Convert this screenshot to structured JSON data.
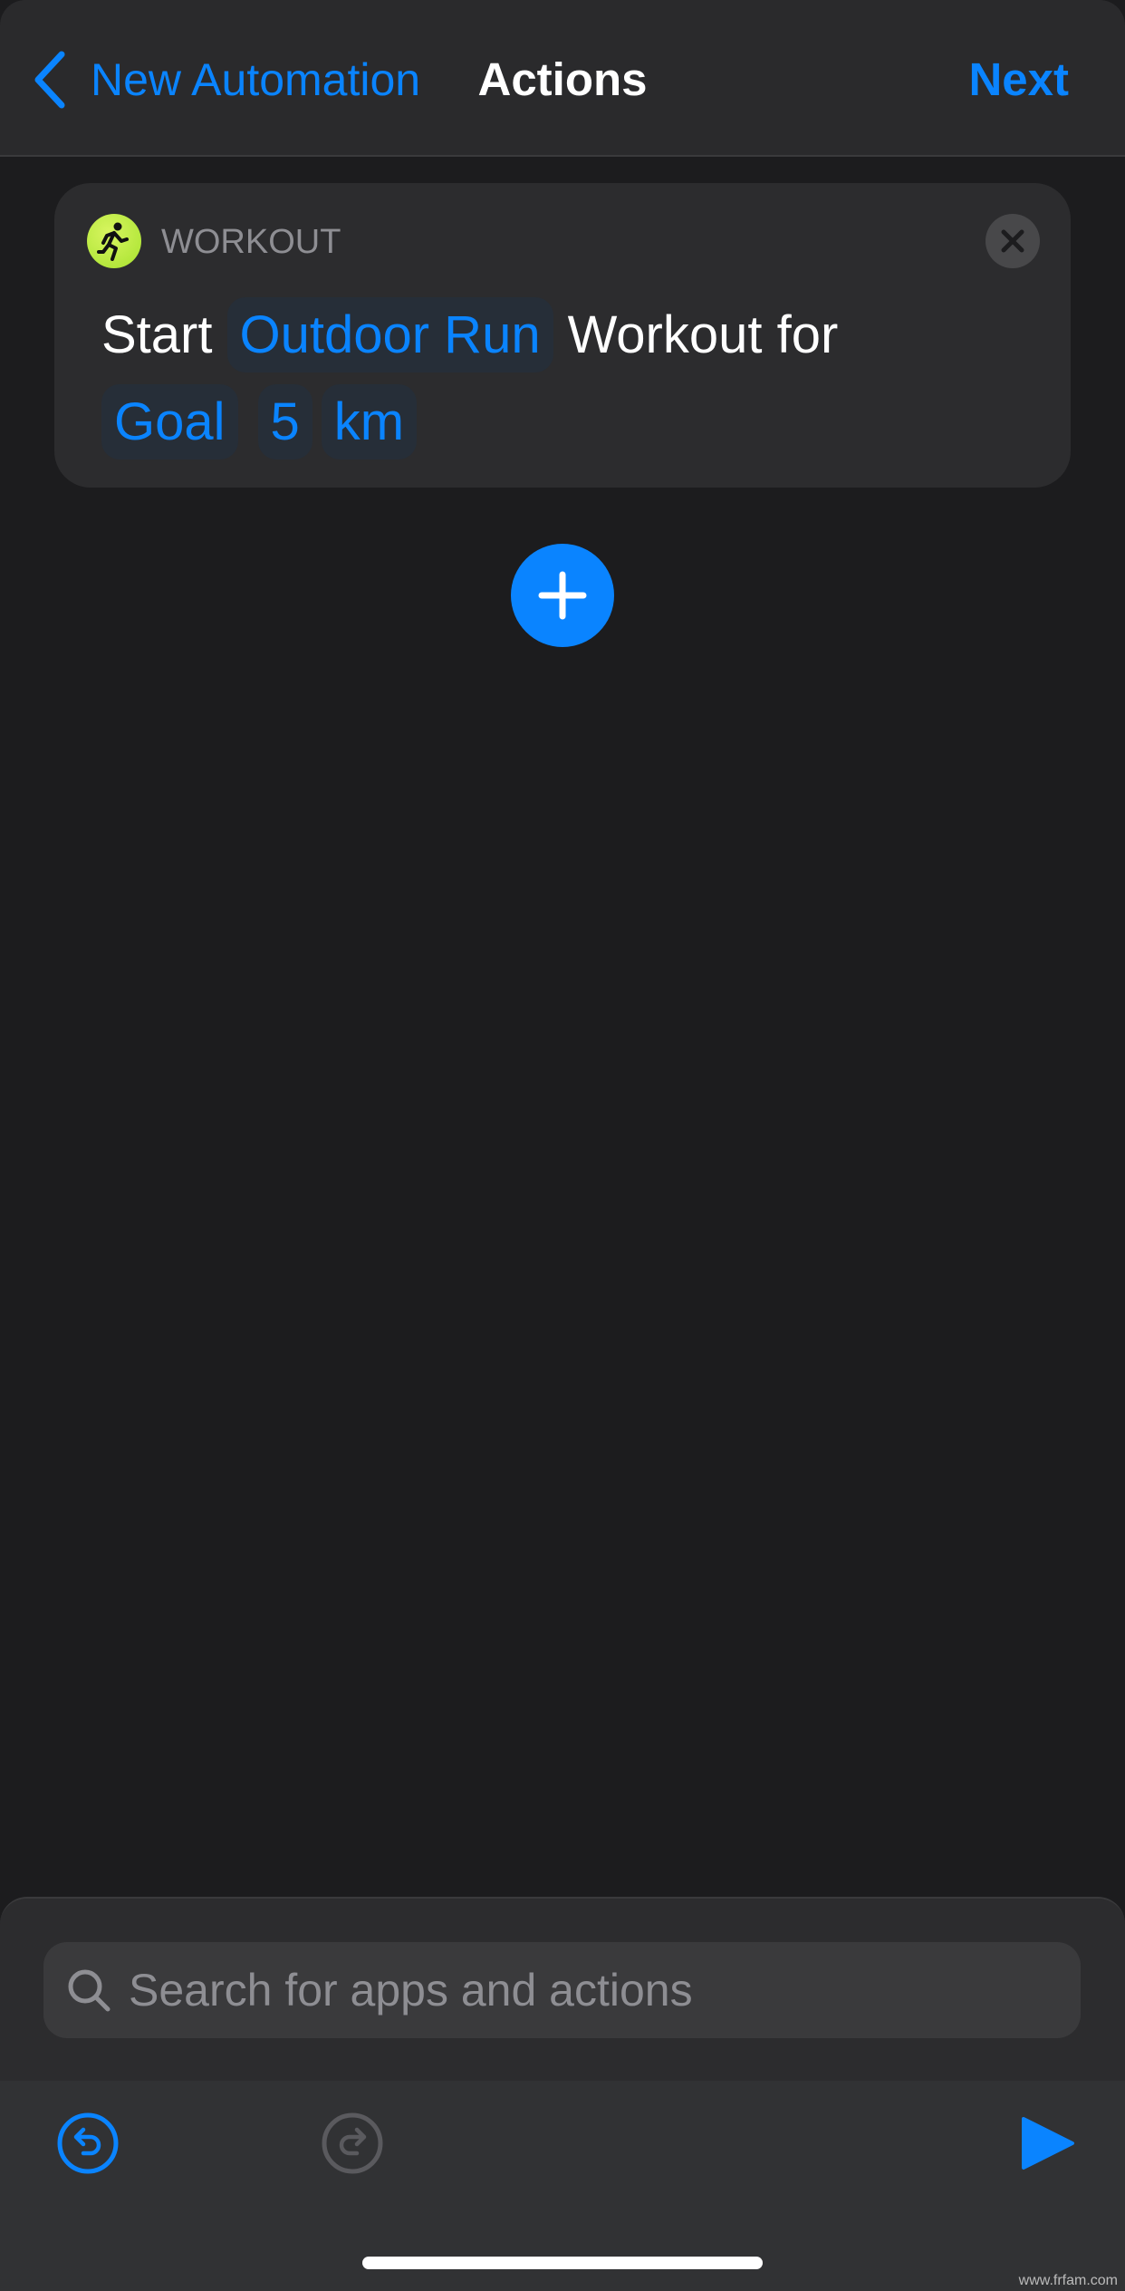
{
  "nav": {
    "back_label": "New Automation",
    "title": "Actions",
    "next_label": "Next"
  },
  "action_card": {
    "app_name": "WORKOUT",
    "app_icon": "running-figure-icon",
    "app_icon_color": "#b5ea3c",
    "text_start": "Start",
    "workout_type": "Outdoor Run",
    "text_workout_for": "Workout for",
    "goal": "Goal",
    "goal_value": "5",
    "goal_unit": "km"
  },
  "search": {
    "placeholder": "Search for apps and actions",
    "value": ""
  },
  "toolbar": {
    "undo": "undo-icon",
    "redo": "redo-icon",
    "run": "play-icon"
  },
  "colors": {
    "accent": "#0a84ff",
    "background": "#1c1c1e",
    "card": "#2c2c2e"
  },
  "watermark": "www.frfam.com"
}
